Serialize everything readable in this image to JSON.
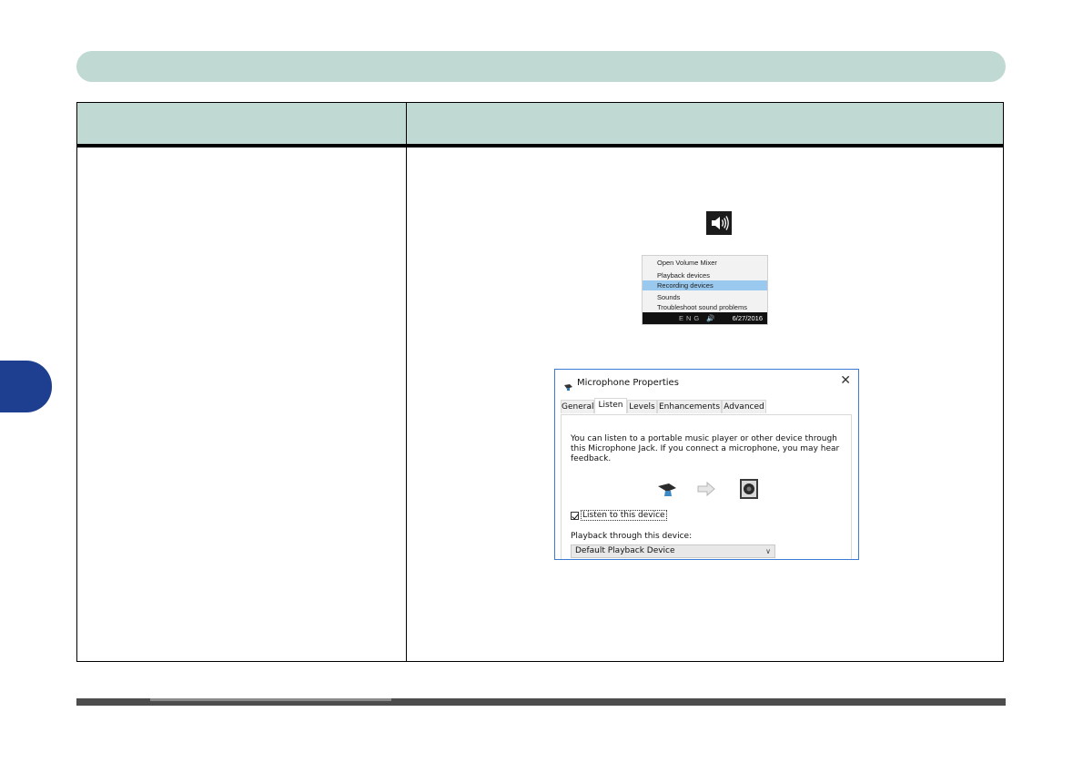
{
  "context_menu": {
    "items": [
      {
        "label": "Open Volume Mixer"
      },
      {
        "label": "Playback devices"
      },
      {
        "label": "Recording devices"
      },
      {
        "label": "Sounds"
      },
      {
        "label": "Troubleshoot sound problems"
      }
    ],
    "selected_index": 2,
    "taskbar_date": "6/27/2016",
    "taskbar_tray": "ENG 🔊"
  },
  "dialog": {
    "title": "Microphone Properties",
    "close_glyph": "✕",
    "tabs": [
      "General",
      "Listen",
      "Levels",
      "Enhancements",
      "Advanced"
    ],
    "active_tab": "Listen",
    "description": "You can listen to a portable music player or other device through this Microphone Jack.  If you connect a microphone, you may hear feedback.",
    "checkbox_label": "Listen to this device",
    "checkbox_checked": true,
    "playback_label": "Playback through this device:",
    "playback_value": "Default Playback Device"
  },
  "colors": {
    "header_band": "#c1d9d3",
    "side_tab": "#1e3f8f",
    "menu_highlight": "#99c9ef"
  },
  "icons": [
    "speaker-icon",
    "microphone-icon",
    "arrow-right-icon",
    "speaker-device-icon",
    "chevron-down-icon",
    "close-icon"
  ]
}
